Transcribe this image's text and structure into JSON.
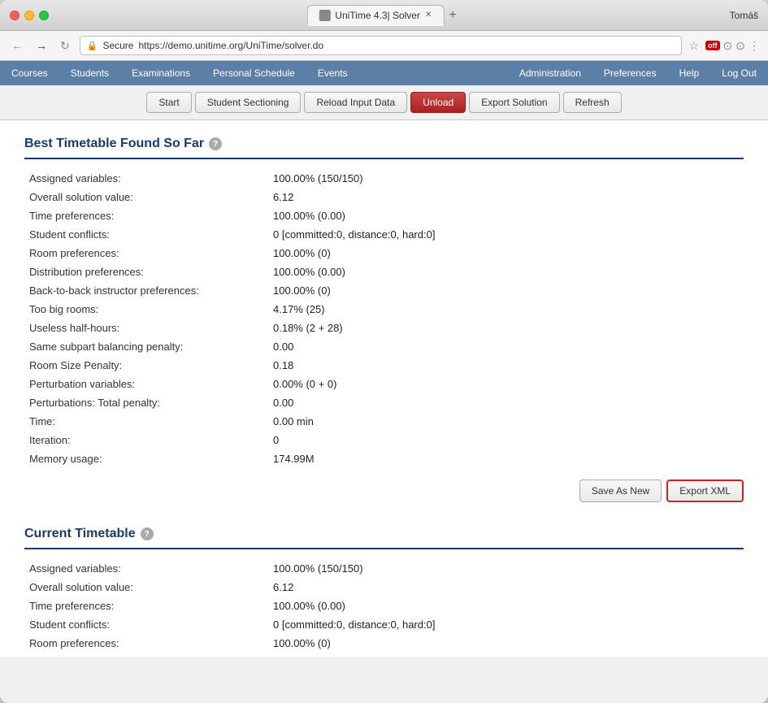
{
  "browser": {
    "title": "UniTime 4.3| Solver",
    "tab_label": "UniTime 4.3| Solver",
    "url": "https://demo.unitime.org/UniTime/solver.do",
    "secure_label": "Secure",
    "user": "Tomáš",
    "new_tab_placeholder": "+"
  },
  "nav": {
    "items": [
      {
        "label": "Courses"
      },
      {
        "label": "Students"
      },
      {
        "label": "Examinations"
      },
      {
        "label": "Personal Schedule"
      },
      {
        "label": "Events"
      },
      {
        "label": "Administration"
      },
      {
        "label": "Preferences"
      },
      {
        "label": "Help"
      },
      {
        "label": "Log Out"
      }
    ]
  },
  "toolbar": {
    "buttons": [
      {
        "label": "Start",
        "style": "normal"
      },
      {
        "label": "Student Sectioning",
        "style": "normal"
      },
      {
        "label": "Reload Input Data",
        "style": "normal"
      },
      {
        "label": "Unload",
        "style": "unload"
      },
      {
        "label": "Export Solution",
        "style": "normal"
      },
      {
        "label": "Refresh",
        "style": "normal"
      }
    ]
  },
  "best_timetable": {
    "title": "Best Timetable Found So Far",
    "rows": [
      {
        "label": "Assigned variables:",
        "value": "100.00% (150/150)"
      },
      {
        "label": "Overall solution value:",
        "value": "6.12"
      },
      {
        "label": "Time preferences:",
        "value": "100.00% (0.00)"
      },
      {
        "label": "Student conflicts:",
        "value": "0 [committed:0, distance:0, hard:0]"
      },
      {
        "label": "Room preferences:",
        "value": "100.00% (0)"
      },
      {
        "label": "Distribution preferences:",
        "value": "100.00% (0.00)"
      },
      {
        "label": "Back-to-back instructor preferences:",
        "value": "100.00% (0)"
      },
      {
        "label": "Too big rooms:",
        "value": "4.17% (25)"
      },
      {
        "label": "Useless half-hours:",
        "value": "0.18% (2 + 28)"
      },
      {
        "label": "Same subpart balancing penalty:",
        "value": "0.00"
      },
      {
        "label": "Room Size Penalty:",
        "value": "0.18"
      },
      {
        "label": "Perturbation variables:",
        "value": "0.00% (0 + 0)"
      },
      {
        "label": "Perturbations: Total penalty:",
        "value": "0.00"
      },
      {
        "label": "Time:",
        "value": "0.00 min"
      },
      {
        "label": "Iteration:",
        "value": "0"
      },
      {
        "label": "Memory usage:",
        "value": "174.99M"
      }
    ],
    "buttons": {
      "save_as_new": "Save As New",
      "export_xml": "Export XML"
    }
  },
  "current_timetable": {
    "title": "Current Timetable",
    "rows": [
      {
        "label": "Assigned variables:",
        "value": "100.00% (150/150)"
      },
      {
        "label": "Overall solution value:",
        "value": "6.12"
      },
      {
        "label": "Time preferences:",
        "value": "100.00% (0.00)"
      },
      {
        "label": "Student conflicts:",
        "value": "0 [committed:0, distance:0, hard:0]"
      },
      {
        "label": "Room preferences:",
        "value": "100.00% (0)"
      }
    ]
  }
}
